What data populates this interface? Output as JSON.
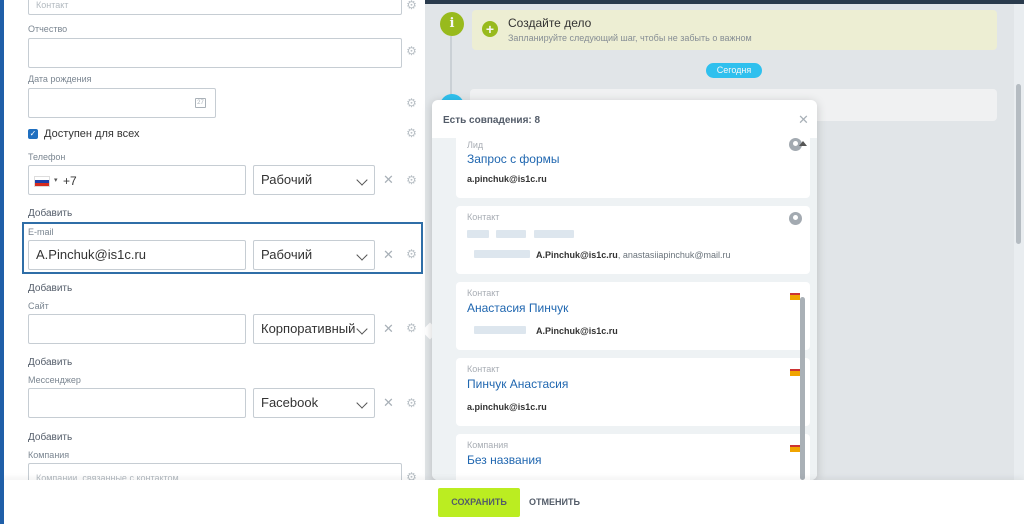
{
  "form": {
    "top_placeholder": "Контакт",
    "patronymic_label": "Отчество",
    "birthdate_label": "Дата рождения",
    "available_label": "Доступен для всех",
    "phone": {
      "label": "Телефон",
      "code": "+7",
      "type": "Рабочий"
    },
    "add_label": "Добавить",
    "email": {
      "label": "E-mail",
      "value": "A.Pinchuk@is1c.ru",
      "type": "Рабочий"
    },
    "site": {
      "label": "Сайт",
      "type": "Корпоративный"
    },
    "messenger": {
      "label": "Мессенджер",
      "type": "Facebook"
    },
    "company": {
      "label": "Компания",
      "placeholder": "Компании, связанные с контактом"
    }
  },
  "timeline": {
    "todo_title": "Создайте дело",
    "todo_hint": "Запланируйте следующий шаг, чтобы не забыть о важном",
    "today_badge": "Сегодня"
  },
  "duplicates": {
    "title": "Есть совпадения: 8",
    "items": [
      {
        "type": "Лид",
        "name": "Запрос с формы",
        "email": "a.pinchuk@is1c.ru"
      },
      {
        "type": "Контакт",
        "name": "",
        "email": "A.Pinchuk@is1c.ru",
        "email_extra": ", anastasiiapinchuk@mail.ru"
      },
      {
        "type": "Контакт",
        "name": "Анастасия Пинчук",
        "email": "A.Pinchuk@is1c.ru"
      },
      {
        "type": "Контакт",
        "name": "Пинчук Анастасия",
        "email": "a.pinchuk@is1c.ru"
      },
      {
        "type": "Компания",
        "name": "Без названия"
      }
    ]
  },
  "footer": {
    "save": "СОХРАНИТЬ",
    "cancel": "ОТМЕНИТЬ"
  },
  "colors": {
    "accent": "#bbed21",
    "link": "#2067b0",
    "focus": "#2f6ea7",
    "today": "#2fc6f6"
  }
}
